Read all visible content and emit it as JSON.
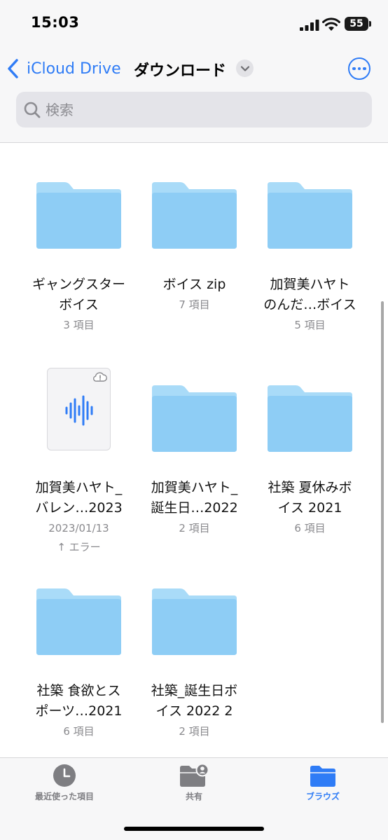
{
  "status_bar": {
    "time": "15:03",
    "battery": "55"
  },
  "nav": {
    "back_label": "iCloud Drive",
    "title": "ダウンロード"
  },
  "search": {
    "placeholder": "検索"
  },
  "items": [
    {
      "type": "folder",
      "name_line1": "ギャングスター",
      "name_line2": "ボイス",
      "meta": "3 項目"
    },
    {
      "type": "folder",
      "name_line1": "ボイス zip",
      "name_line2": "",
      "meta": "7 項目"
    },
    {
      "type": "folder",
      "name_line1": "加賀美ハヤト",
      "name_line2": "のんだ…ボイス",
      "meta": "5 項目"
    },
    {
      "type": "audio",
      "name_line1": "加賀美ハヤト_",
      "name_line2": "バレン…2023",
      "meta": "2023/01/13",
      "status": "↑ エラー"
    },
    {
      "type": "folder",
      "name_line1": "加賀美ハヤト_",
      "name_line2": "誕生日…2022",
      "meta": "2 項目"
    },
    {
      "type": "folder",
      "name_line1": "社築 夏休みボ",
      "name_line2": "イス 2021",
      "meta": "6 項目"
    },
    {
      "type": "folder",
      "name_line1": "社築 食欲とス",
      "name_line2": "ポーツ…2021",
      "meta": "6 項目"
    },
    {
      "type": "folder",
      "name_line1": "社築_誕生日ボ",
      "name_line2": "イス 2022 2",
      "meta": "2 項目"
    }
  ],
  "tabbar": {
    "recents": "最近使った項目",
    "shared": "共有",
    "browse": "ブラウズ"
  },
  "colors": {
    "accent": "#2f7cf6",
    "folder": "#8ecdf5",
    "folder_tab": "#a9dbf8"
  }
}
